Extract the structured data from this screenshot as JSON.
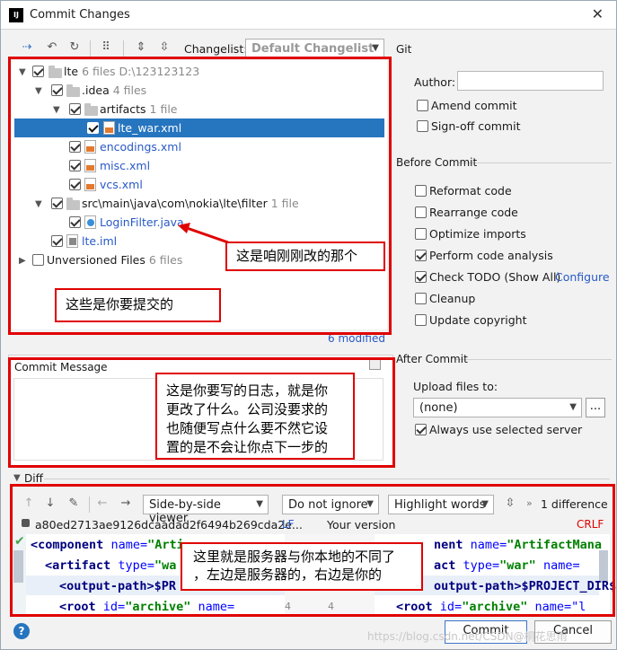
{
  "window": {
    "title": "Commit Changes",
    "close_glyph": "✕",
    "logo_text": "IJ"
  },
  "toolbar": {
    "changelist_label": "Changelist:",
    "changelist_value": "Default Changelist"
  },
  "tree": {
    "root": {
      "name": "lte",
      "count": "6 files",
      "path": "D:\\123123123"
    },
    "idea": {
      "name": ".idea",
      "count": "4 files"
    },
    "artifacts": {
      "name": "artifacts",
      "count": "1 file"
    },
    "files": [
      {
        "name": "lte_war.xml"
      },
      {
        "name": "encodings.xml"
      },
      {
        "name": "misc.xml"
      },
      {
        "name": "vcs.xml"
      }
    ],
    "filter": {
      "name": "src\\main\\java\\com\\nokia\\lte\\filter",
      "count": "1 file"
    },
    "loginfilter": {
      "name": "LoginFilter.java"
    },
    "iml": {
      "name": "lte.iml"
    },
    "unversioned": {
      "name": "Unversioned Files",
      "count": "6 files"
    },
    "modified": "6 modified"
  },
  "annotations": {
    "changed_file": "这是咱刚刚改的那个",
    "to_commit": "这些是你要提交的",
    "log_line1": "这是你要写的日志，就是你",
    "log_line2": "更改了什么。公司没要求的",
    "log_line3": "也随便写点什么要不然它设",
    "log_line4": "置的是不会让你点下一步的",
    "diff_line1": "这里就是服务器与你本地的不同了",
    "diff_line2": "，左边是服务器的，右边是你的"
  },
  "commit_message": {
    "label": "Commit Message"
  },
  "git": {
    "title": "Git",
    "author_label": "Author:",
    "author_value": "",
    "amend": "Amend commit",
    "signoff": "Sign-off commit"
  },
  "before_commit": {
    "title": "Before Commit",
    "reformat": "Reformat code",
    "rearrange": "Rearrange code",
    "optimize": "Optimize imports",
    "analysis": "Perform code analysis",
    "todo": "Check TODO (Show All)",
    "configure": "Configure",
    "cleanup": "Cleanup",
    "copyright": "Update copyright"
  },
  "after_commit": {
    "title": "After Commit",
    "upload_label": "Upload files to:",
    "upload_value": "(none)",
    "browse": "...",
    "always": "Always use selected server"
  },
  "diff": {
    "title": "Diff",
    "viewer": "Side-by-side viewer",
    "ignore": "Do not ignore",
    "highlight": "Highlight words",
    "differences": "1 difference",
    "hash": "a80ed2713ae9126dcaadad2f6494b269cda2e...",
    "lf": "LF",
    "your_version": "Your version",
    "crlf": "CRLF",
    "left_line1_tag": "component",
    "left_line1_attr": "name=",
    "left_line1_str": "\"Arti",
    "left_line2_tag": "artifact",
    "left_line2_attr": "type=",
    "left_line2_str": "\"wa",
    "left_line3": "<output-path>$PR",
    "left_line4_tag": "root",
    "left_line4_attr": "id=",
    "left_line4_str": "\"archive\"",
    "left_line4_tail": " name=",
    "right_line1": "nent",
    "right_line1_attr": "name=",
    "right_line1_str": "\"ArtifactMana",
    "right_line2": "act",
    "right_line2_attr": "type=",
    "right_line2_str": "\"war\"",
    "right_line2_tail": " name=",
    "right_line3": "output-path>$PROJECT_DIR$/",
    "right_line4_tag": "root",
    "right_line4_attr": "id=",
    "right_line4_str": "\"archive\"",
    "right_line4_tail": " name=\"l",
    "gutter_num": "4"
  },
  "buttons": {
    "commit": "Commit",
    "cancel": "Cancel",
    "help": "?"
  },
  "watermark": "https://blog.csdn.net/CSDN@桐花思雨"
}
